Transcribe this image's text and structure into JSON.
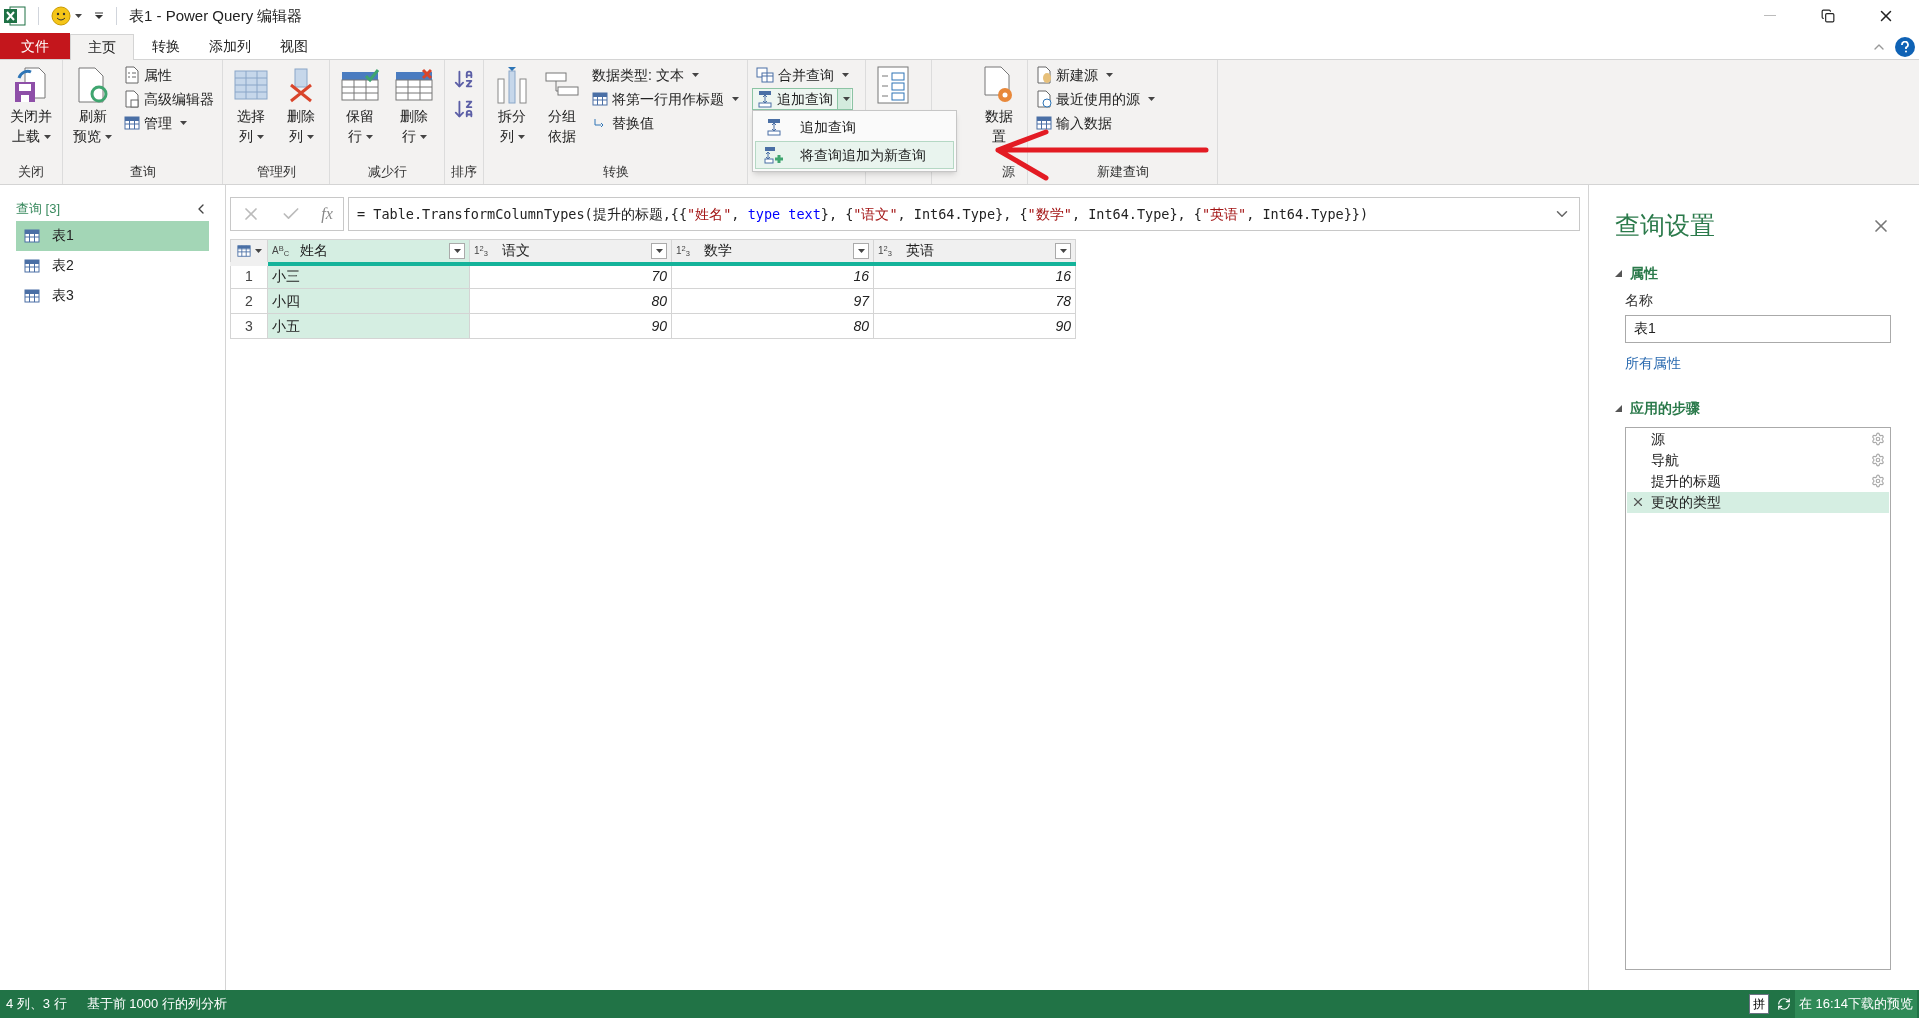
{
  "window": {
    "title": "表1 - Power Query 编辑器"
  },
  "ribbon_tabs": [
    {
      "label": "文件",
      "kind": "file",
      "selected": false
    },
    {
      "label": "主页",
      "kind": "tab",
      "selected": true
    },
    {
      "label": "转换",
      "kind": "tab",
      "selected": false
    },
    {
      "label": "添加列",
      "kind": "tab",
      "selected": false
    },
    {
      "label": "视图",
      "kind": "tab",
      "selected": false
    }
  ],
  "ribbon_groups": [
    {
      "label": "关闭",
      "items": [
        {
          "kind": "large",
          "lines": [
            "关闭并",
            "上载"
          ],
          "dropdown": true
        }
      ]
    },
    {
      "label": "查询",
      "items": [
        {
          "kind": "large",
          "lines": [
            "刷新",
            "预览"
          ],
          "dropdown": true
        },
        {
          "kind": "stack",
          "entries": [
            {
              "label": "属性",
              "dropdown": false
            },
            {
              "label": "高级编辑器",
              "dropdown": false
            },
            {
              "label": "管理",
              "dropdown": true
            }
          ]
        }
      ]
    },
    {
      "label": "管理列",
      "items": [
        {
          "kind": "large",
          "lines": [
            "选择",
            "列"
          ],
          "dropdown": true
        },
        {
          "kind": "large",
          "lines": [
            "删除",
            "列"
          ],
          "dropdown": true
        }
      ]
    },
    {
      "label": "减少行",
      "items": [
        {
          "kind": "large",
          "lines": [
            "保留",
            "行"
          ],
          "dropdown": true
        },
        {
          "kind": "large",
          "lines": [
            "删除",
            "行"
          ],
          "dropdown": true
        }
      ]
    },
    {
      "label": "排序",
      "items": [
        {
          "kind": "sort"
        }
      ]
    },
    {
      "label": "转换",
      "items": [
        {
          "kind": "large",
          "lines": [
            "拆分",
            "列"
          ],
          "dropdown": true
        },
        {
          "kind": "large",
          "lines": [
            "分组",
            "依据"
          ],
          "dropdown": false
        },
        {
          "kind": "stack",
          "entries": [
            {
              "label": "数据类型: 文本",
              "dropdown": true
            },
            {
              "label": "将第一行用作标题",
              "dropdown": true
            },
            {
              "label": "替换值",
              "dropdown": false
            }
          ]
        }
      ]
    },
    {
      "items": [
        {
          "kind": "stack",
          "entries": [
            {
              "label": "合并查询",
              "dropdown": true
            },
            {
              "label": "追加查询",
              "dropdown": true,
              "split": true,
              "open": true
            }
          ]
        }
      ]
    },
    {
      "items": [
        {
          "kind": "large"
        }
      ]
    },
    {
      "label": "源",
      "items": [
        {
          "kind": "large",
          "lines": [
            "数据",
            "置"
          ],
          "dropdown": false
        }
      ]
    },
    {
      "label": "新建查询",
      "items": [
        {
          "kind": "stack",
          "entries": [
            {
              "label": "新建源",
              "dropdown": true
            },
            {
              "label": "最近使用的源",
              "dropdown": true
            },
            {
              "label": "输入数据",
              "dropdown": false
            }
          ]
        }
      ]
    }
  ],
  "append_menu": [
    {
      "label": "追加查询",
      "selected": false
    },
    {
      "label": "将查询追加为新查询",
      "selected": true
    }
  ],
  "queries_panel": {
    "header": "查询 [3]",
    "items": [
      {
        "label": "表1",
        "selected": true
      },
      {
        "label": "表2",
        "selected": false
      },
      {
        "label": "表3",
        "selected": false
      }
    ]
  },
  "formula_bar": {
    "fx": "fx",
    "tokens": [
      {
        "text": "= Table.TransformColumnTypes(提升的标题,{{",
        "kind": "plain"
      },
      {
        "text": "\"姓名\"",
        "kind": "string"
      },
      {
        "text": ", ",
        "kind": "plain"
      },
      {
        "text": "type text",
        "kind": "keyword"
      },
      {
        "text": "}, {",
        "kind": "plain"
      },
      {
        "text": "\"语文\"",
        "kind": "string"
      },
      {
        "text": ", Int64.Type}, {",
        "kind": "plain"
      },
      {
        "text": "\"数学\"",
        "kind": "string"
      },
      {
        "text": ", Int64.Type}, {",
        "kind": "plain"
      },
      {
        "text": "\"英语\"",
        "kind": "string"
      },
      {
        "text": ", Int64.Type}})",
        "kind": "plain"
      }
    ]
  },
  "table": {
    "columns": [
      {
        "type": "A$^{B}$$_{C}$",
        "name": "姓名",
        "selected": true
      },
      {
        "type": "1$^{2}$$_{3}$",
        "name": "语文",
        "selected": false
      },
      {
        "type": "1$^{2}$$_{3}$",
        "name": "数学",
        "selected": false
      },
      {
        "type": "1$^{2}$$_{3}$",
        "name": "英语",
        "selected": false
      }
    ],
    "rows": [
      {
        "number": "1",
        "cells": [
          "小三",
          "70",
          "16",
          "16"
        ]
      },
      {
        "number": "2",
        "cells": [
          "小四",
          "80",
          "97",
          "78"
        ]
      },
      {
        "number": "3",
        "cells": [
          "小五",
          "90",
          "80",
          "90"
        ]
      }
    ]
  },
  "settings": {
    "title": "查询设置",
    "properties_header": "属性",
    "name_label": "名称",
    "name_value": "表1",
    "all_properties": "所有属性",
    "steps_header": "应用的步骤",
    "steps": [
      {
        "label": "源",
        "selected": false,
        "settings": true
      },
      {
        "label": "导航",
        "selected": false,
        "settings": true
      },
      {
        "label": "提升的标题",
        "selected": false,
        "settings": true
      },
      {
        "label": "更改的类型",
        "selected": true,
        "settings": false
      }
    ]
  },
  "status_bar": {
    "left": [
      "4 列、3 行",
      "基于前 1000 行的列分析"
    ],
    "ime": "拼",
    "preview": "在 16:14下载的预览"
  }
}
